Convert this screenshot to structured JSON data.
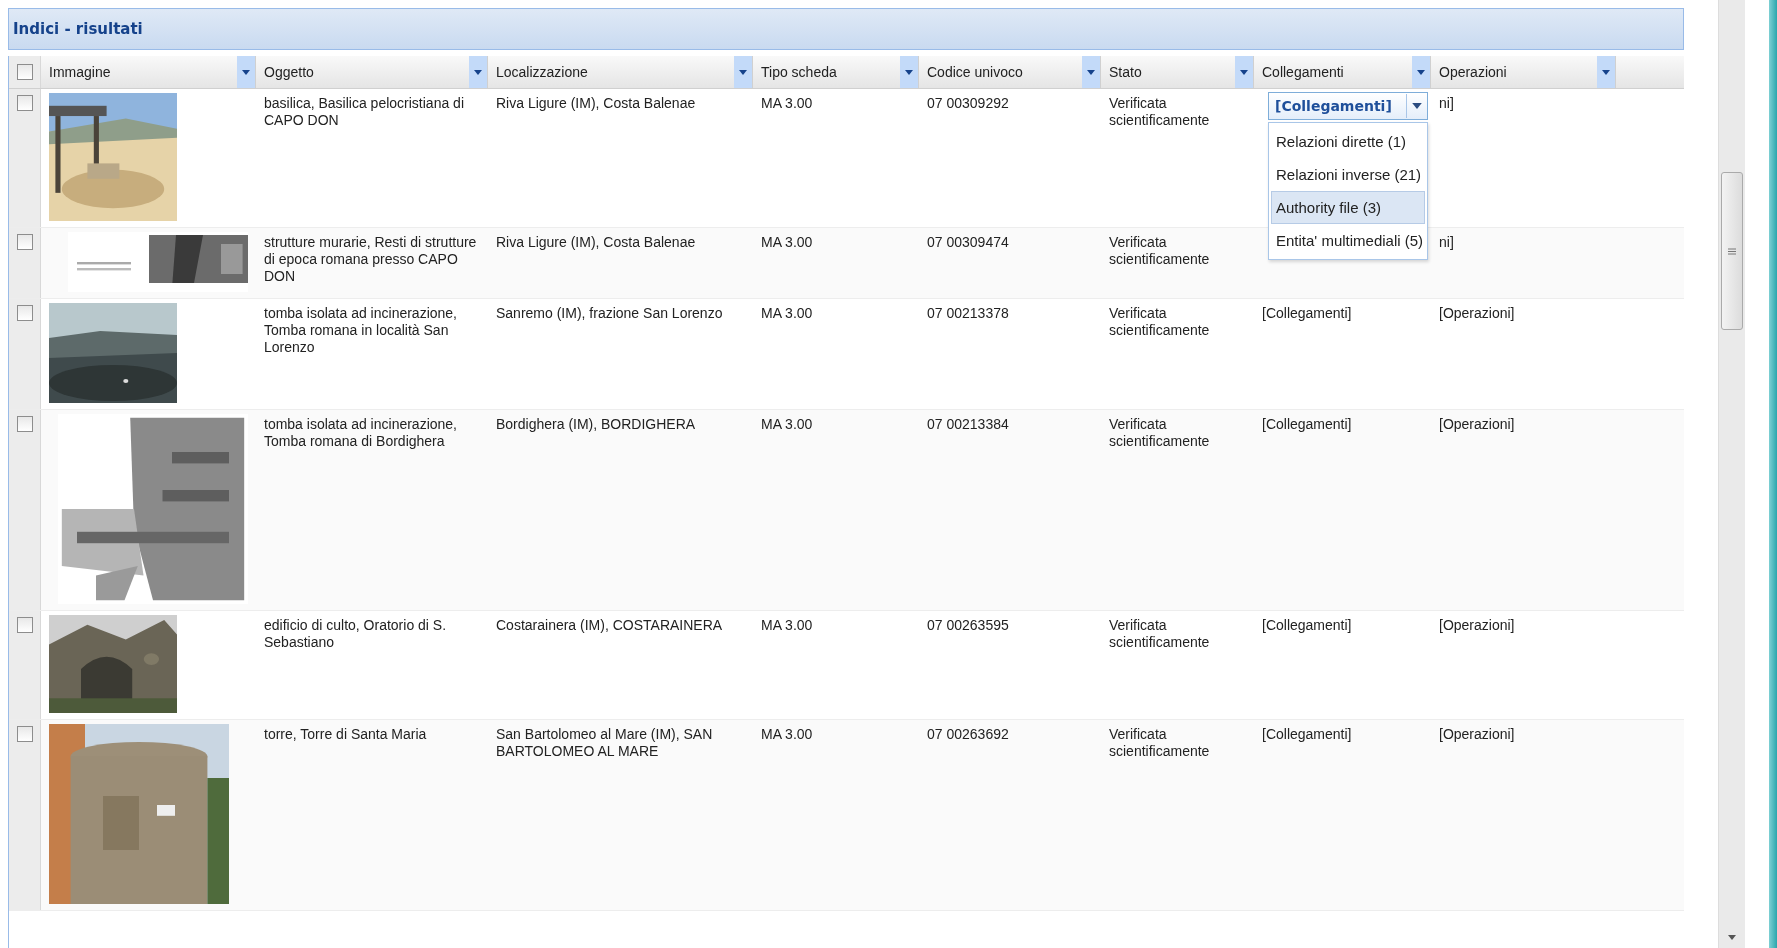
{
  "panel": {
    "title": "Indici - risultati"
  },
  "table": {
    "header_checked": false,
    "columns": [
      "Immagine",
      "Oggetto",
      "Localizzazione",
      "Tipo scheda",
      "Codice univoco",
      "Stato",
      "Collegamenti",
      "Operazioni"
    ],
    "rows": [
      {
        "checked": false,
        "oggetto": "basilica, Basilica pelocristiana di CAPO DON",
        "localizzazione": "Riva Ligure (IM), Costa Balenae",
        "tipo": "MA 3.00",
        "codice": "07 00309292",
        "stato": "Verificata scientificamente",
        "collegamenti_menu": {
          "value": "[Collegamenti]",
          "options": [
            {
              "label": "Relazioni dirette (1)",
              "selected": false
            },
            {
              "label": "Relazioni inverse (21)",
              "selected": false
            },
            {
              "label": "Authority file (3)",
              "selected": true
            },
            {
              "label": "Entita' multimediali (5)",
              "selected": false
            }
          ]
        },
        "operazioni": "ni]"
      },
      {
        "checked": false,
        "oggetto": "strutture murarie, Resti di strutture di epoca romana presso CAPO DON",
        "localizzazione": "Riva Ligure (IM), Costa Balenae",
        "tipo": "MA 3.00",
        "codice": "07 00309474",
        "stato": "Verificata scientificamente",
        "operazioni": "ni]"
      },
      {
        "checked": false,
        "oggetto": "tomba isolata ad incinerazione, Tomba romana in località San Lorenzo",
        "localizzazione": "Sanremo (IM), frazione San Lorenzo",
        "tipo": "MA 3.00",
        "codice": "07 00213378",
        "stato": "Verificata scientificamente",
        "collegamenti": "[Collegamenti]",
        "operazioni": "[Operazioni]"
      },
      {
        "checked": false,
        "oggetto": "tomba isolata ad incinerazione, Tomba romana di Bordighera",
        "localizzazione": "Bordighera (IM), BORDIGHERA",
        "tipo": "MA 3.00",
        "codice": "07 00213384",
        "stato": "Verificata scientificamente",
        "collegamenti": "[Collegamenti]",
        "operazioni": "[Operazioni]"
      },
      {
        "checked": false,
        "oggetto": "edificio di culto, Oratorio di S. Sebastiano",
        "localizzazione": "Costarainera (IM), COSTARAINERA",
        "tipo": "MA 3.00",
        "codice": "07 00263595",
        "stato": "Verificata scientificamente",
        "collegamenti": "[Collegamenti]",
        "operazioni": "[Operazioni]"
      },
      {
        "checked": false,
        "oggetto": "torre, Torre di Santa Maria",
        "localizzazione": "San Bartolomeo al Mare (IM), SAN BARTOLOMEO AL MARE",
        "tipo": "MA 3.00",
        "codice": "07 00263692",
        "stato": "Verificata scientificamente",
        "collegamenti": "[Collegamenti]",
        "operazioni": "[Operazioni]"
      }
    ]
  }
}
